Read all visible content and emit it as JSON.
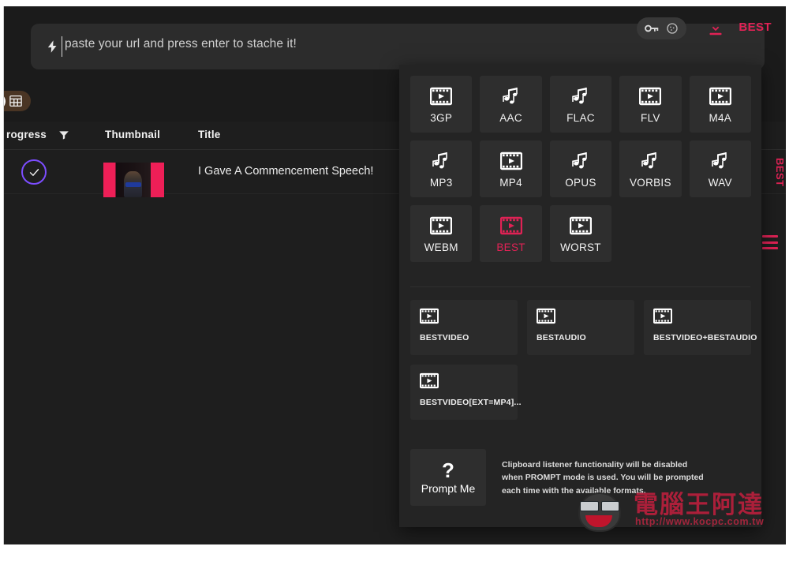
{
  "app": {
    "background_color": "#1e1e1e",
    "accent_color": "#e02255",
    "panel_color": "#242424"
  },
  "search": {
    "placeholder": "paste your url and press enter to stache it!",
    "value": "",
    "bolt_icon": "lightning-bolt-icon",
    "key_icon": "key-icon",
    "cookie_icon": "cookie-icon",
    "download_icon": "download-icon",
    "format_label": "BEST"
  },
  "toolbar": {
    "view_toggle_icon": "grid-view-icon",
    "view_toggle_on": true
  },
  "table": {
    "columns": [
      {
        "label": "rogress",
        "name": "progress"
      },
      {
        "label": "Thumbnail",
        "name": "thumbnail"
      },
      {
        "label": "Title",
        "name": "title"
      }
    ],
    "filter_icon": "filter-icon",
    "rows": [
      {
        "status_icon": "check-circle-icon",
        "title": "I Gave A Commencement Speech!"
      }
    ]
  },
  "edge": {
    "vertical_text": "BEST",
    "menu_icon": "hamburger-menu-icon"
  },
  "dropdown": {
    "formats": [
      {
        "label": "3GP",
        "icon": "film-icon",
        "accent": false
      },
      {
        "label": "AAC",
        "icon": "music-note-icon",
        "accent": false
      },
      {
        "label": "FLAC",
        "icon": "music-note-icon",
        "accent": false
      },
      {
        "label": "FLV",
        "icon": "film-icon",
        "accent": false
      },
      {
        "label": "M4A",
        "icon": "film-icon",
        "accent": false
      },
      {
        "label": "MP3",
        "icon": "music-note-icon",
        "accent": false
      },
      {
        "label": "MP4",
        "icon": "film-icon",
        "accent": false
      },
      {
        "label": "OPUS",
        "icon": "music-note-icon",
        "accent": false
      },
      {
        "label": "VORBIS",
        "icon": "music-note-icon",
        "accent": false
      },
      {
        "label": "WAV",
        "icon": "music-note-icon",
        "accent": false
      },
      {
        "label": "WEBM",
        "icon": "film-icon",
        "accent": false
      },
      {
        "label": "BEST",
        "icon": "film-icon",
        "accent": true
      },
      {
        "label": "WORST",
        "icon": "film-icon",
        "accent": false
      }
    ],
    "best_options": [
      {
        "label": "BESTVIDEO",
        "icon": "film-icon"
      },
      {
        "label": "BESTAUDIO",
        "icon": "film-icon"
      },
      {
        "label": "BESTVIDEO+BESTAUDIO",
        "icon": "film-icon"
      },
      {
        "label": "BESTVIDEO[EXT=MP4]...",
        "icon": "film-icon"
      }
    ],
    "prompt": {
      "glyph": "?",
      "label": "Prompt Me",
      "note": "Clipboard listener functionality will be disabled when PROMPT mode is used. You will be prompted each time with the available formats."
    }
  },
  "watermark": {
    "text": "電腦王阿達",
    "url": "http://www.kocpc.com.tw"
  }
}
